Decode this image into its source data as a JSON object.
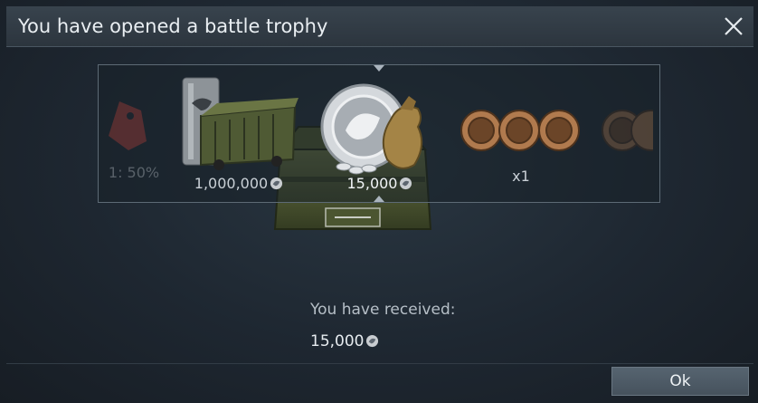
{
  "dialog": {
    "title": "You have opened a battle trophy",
    "ok_label": "Ok"
  },
  "carousel": {
    "items": [
      {
        "icon": "booster-tag-icon",
        "label": "1: 50%"
      },
      {
        "icon": "silver-cargo-icon",
        "label": "1,000,000"
      },
      {
        "icon": "silver-coin-bag-icon",
        "label": "15,000"
      },
      {
        "icon": "bronze-medals-icon",
        "label": "x1"
      },
      {
        "icon": "bronze-medal-icon",
        "label": ""
      }
    ],
    "currency_icon": "silver-lion-icon"
  },
  "result": {
    "received_label": "You have received:",
    "received_value": "15,000"
  },
  "colors": {
    "background": "#1e2731",
    "titlebar": "#333e48",
    "button": "#4f5c68",
    "silver": "#c8ccd0",
    "bronze": "#b07a4e",
    "crate_green": "#5f6b3c"
  }
}
